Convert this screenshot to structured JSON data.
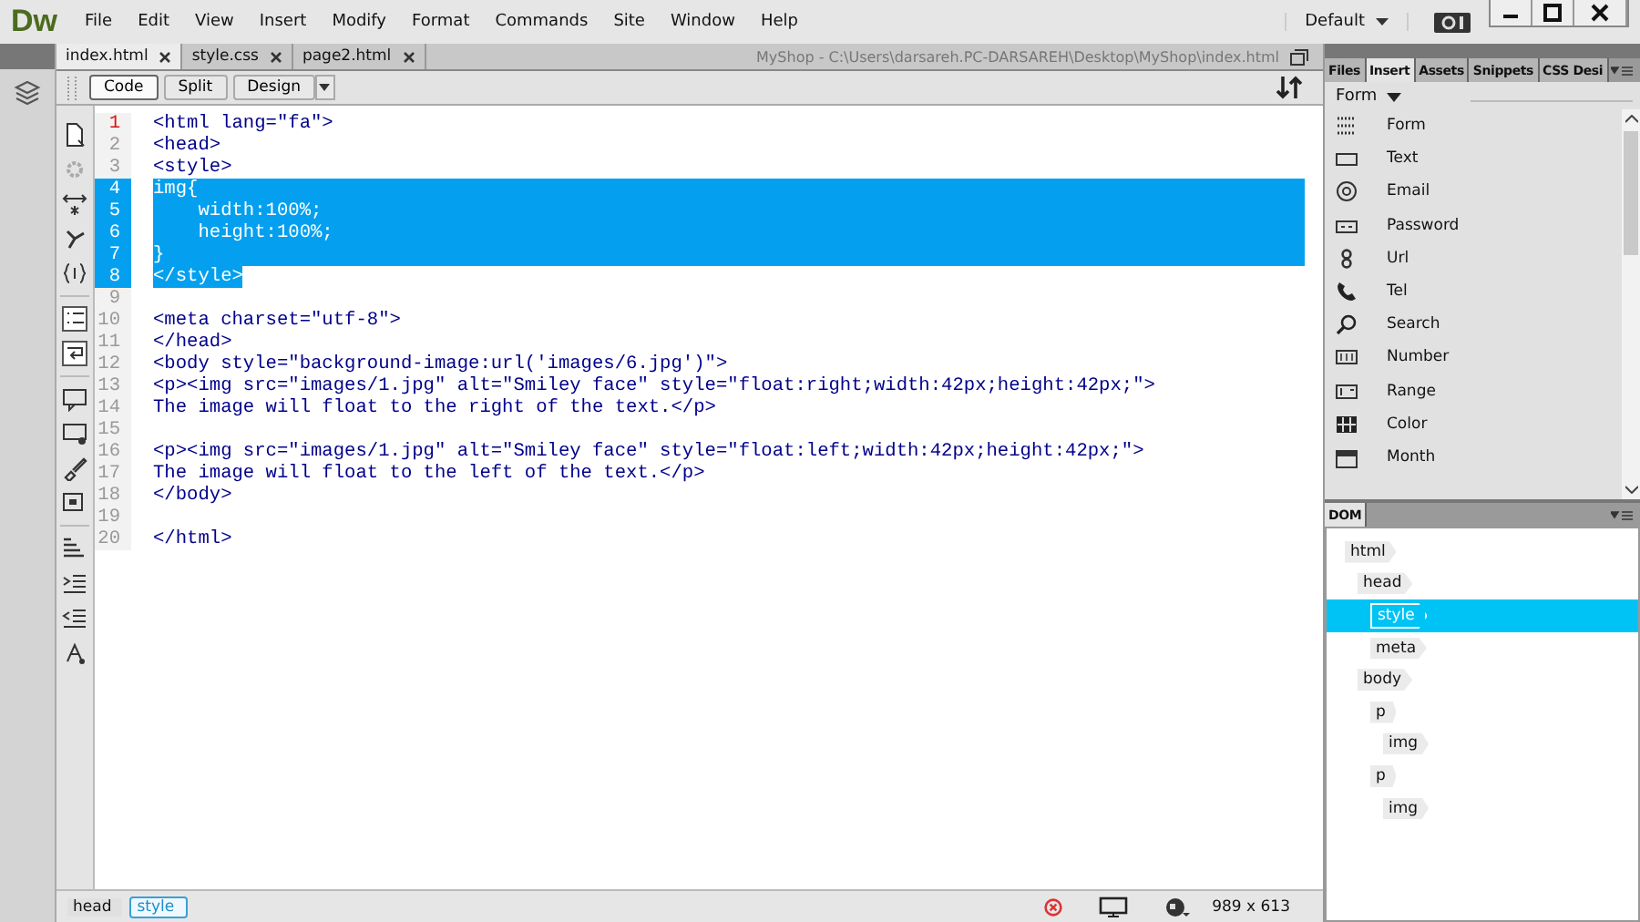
{
  "app": {
    "logo": "Dw",
    "menu": [
      "File",
      "Edit",
      "View",
      "Insert",
      "Modify",
      "Format",
      "Commands",
      "Site",
      "Window",
      "Help"
    ],
    "workspace": "Default"
  },
  "document_tabs": [
    {
      "label": "index.html",
      "selected": true
    },
    {
      "label": "style.css",
      "selected": false
    },
    {
      "label": "page2.html",
      "selected": false
    }
  ],
  "file_path": "MyShop - C:\\Users\\darsareh.PC-DARSAREH\\Desktop\\MyShop\\index.html",
  "view_buttons": [
    {
      "label": "Code",
      "selected": true
    },
    {
      "label": "Split",
      "selected": false
    },
    {
      "label": "Design",
      "selected": false
    }
  ],
  "code_lines": [
    {
      "number": "1",
      "text": "<html lang=\"fa\">",
      "selected": false,
      "current": true
    },
    {
      "number": "2",
      "text": "<head>",
      "selected": false,
      "current": false
    },
    {
      "number": "3",
      "text": "<style>",
      "selected": false,
      "current": false
    },
    {
      "number": "4",
      "text": "img{",
      "selected": true,
      "current": false
    },
    {
      "number": "5",
      "text": "    width:100%;",
      "selected": true,
      "current": false
    },
    {
      "number": "6",
      "text": "    height:100%;",
      "selected": true,
      "current": false
    },
    {
      "number": "7",
      "text": "}",
      "selected": true,
      "current": false
    },
    {
      "number": "8",
      "text": "</style>",
      "selected": true,
      "current": false
    },
    {
      "number": "9",
      "selected": false,
      "current": false
    },
    {
      "number": "10",
      "text": "<meta charset=\"utf-8\">",
      "selected": false,
      "current": false
    },
    {
      "number": "11",
      "text": "</head>",
      "selected": false,
      "current": false
    },
    {
      "number": "12",
      "text": "<body style=\"background-image:url('images/6.jpg')\">",
      "selected": false,
      "current": false
    },
    {
      "number": "13",
      "text": "<p><img src=\"images/1.jpg\" alt=\"Smiley face\" style=\"float:right;width:42px;height:42px;\">",
      "selected": false,
      "current": false
    },
    {
      "number": "14",
      "text": "The image will float to the right of the text.</p>",
      "selected": false,
      "current": false
    },
    {
      "number": "15",
      "selected": false,
      "current": false
    },
    {
      "number": "16",
      "text": "<p><img src=\"images/1.jpg\" alt=\"Smiley face\" style=\"float:left;width:42px;height:42px;\">",
      "selected": false,
      "current": false
    },
    {
      "number": "17",
      "text": "The image will float to the left of the text.</p>",
      "selected": false,
      "current": false
    },
    {
      "number": "18",
      "text": "</body>",
      "selected": false,
      "current": false
    },
    {
      "number": "19",
      "selected": false,
      "current": false
    },
    {
      "number": "20",
      "text": "</html>",
      "selected": false,
      "current": false
    }
  ],
  "panel_tabs": [
    {
      "label": "Files",
      "selected": false
    },
    {
      "label": "Insert",
      "selected": true
    },
    {
      "label": "Assets",
      "selected": false
    },
    {
      "label": "Snippets",
      "selected": false
    },
    {
      "label": "CSS Desi",
      "selected": false
    }
  ],
  "insert_category": "Form",
  "insert_items": [
    "Form",
    "Text",
    "Email",
    "Password",
    "Url",
    "Tel",
    "Search",
    "Number",
    "Range",
    "Color",
    "Month"
  ],
  "dom_tab": "DOM",
  "dom_tree": [
    {
      "label": "html",
      "selected": false,
      "children": [
        {
          "label": "head",
          "selected": false,
          "children": [
            {
              "label": "style",
              "selected": true
            },
            {
              "label": "meta",
              "selected": false
            }
          ]
        },
        {
          "label": "body",
          "selected": false,
          "children": [
            {
              "label": "p",
              "selected": false,
              "children": [
                {
                  "label": "img",
                  "selected": false
                }
              ]
            },
            {
              "label": "p",
              "selected": false,
              "children": [
                {
                  "label": "img",
                  "selected": false
                }
              ]
            }
          ]
        }
      ]
    }
  ],
  "status_bar": {
    "tag_path": [
      {
        "label": "head",
        "selected": false
      },
      {
        "label": "style",
        "selected": true
      }
    ],
    "size": "989 x 613"
  }
}
